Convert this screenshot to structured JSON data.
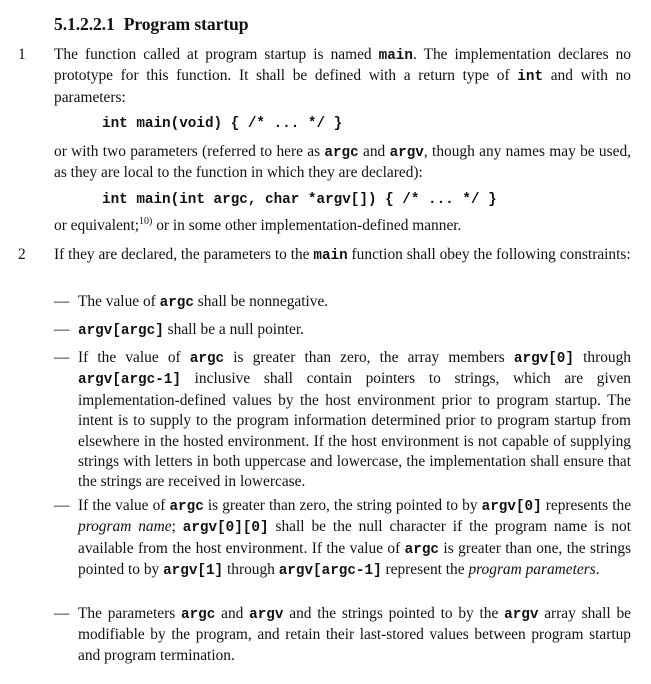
{
  "section": {
    "number": "5.1.2.2.1",
    "title": "Program startup"
  },
  "paragraphs": [
    {
      "number": "1",
      "text_1": "The function called at program startup is named ",
      "code_main": "main",
      "text_2": ". The implementation declares no prototype for this function.  It shall be defined with a return type of ",
      "code_int": "int",
      "text_3": " and with no parameters:",
      "code_example_1": "int main(void) { /* ... */ }",
      "text_4": "or with two parameters (referred to here as ",
      "code_argc": "argc",
      "text_5": " and ",
      "code_argv": "argv",
      "text_6": ", though any names may be used, as they are local to the function in which they are declared):",
      "code_example_2": "int main(int argc, char *argv[]) { /* ... */ }",
      "text_7": "or equivalent;",
      "footnote_ref": "10)",
      "text_8": " or in some other implementation-defined manner."
    },
    {
      "number": "2",
      "text_1": "If they are declared, the parameters to the ",
      "code_main": "main",
      "text_2": " function shall obey the following constraints:"
    }
  ],
  "constraints": [
    {
      "dash": "—",
      "t1": "The value of ",
      "c1": "argc",
      "t2": " shall be nonnegative."
    },
    {
      "dash": "—",
      "c1": "argv[argc]",
      "t1": " shall be a null pointer."
    },
    {
      "dash": "—",
      "t1": "If the value of ",
      "c1": "argc",
      "t2": " is greater than zero, the array members ",
      "c2": "argv[0]",
      "t3": " through ",
      "c3": "argv[argc-1]",
      "t4": " inclusive shall contain pointers to strings, which are given implementation-defined values by the host environment prior to program startup.  The intent is to supply to the program information determined prior to program startup from elsewhere in the hosted environment.  If the host environment is not capable of supplying strings with letters in both uppercase and lowercase, the implementation shall ensure that the strings are received in lowercase."
    },
    {
      "dash": "—",
      "t1": "If the value of ",
      "c1": "argc",
      "t2": " is greater than zero, the string pointed to by ",
      "c2": "argv[0]",
      "t3": " represents the ",
      "i1": "program name",
      "t4": "; ",
      "c3": "argv[0][0]",
      "t5": " shall be the null character if the program name is not available from the host environment.  If the value of ",
      "c4": "argc",
      "t6": " is greater than one, the strings pointed to by ",
      "c5": "argv[1]",
      "t7": " through ",
      "c6": "argv[argc-1]",
      "t8": " represent the ",
      "i2": "program parameters",
      "t9": "."
    },
    {
      "dash": "—",
      "t1": "The parameters ",
      "c1": "argc",
      "t2": " and ",
      "c2": "argv",
      "t3": " and the strings pointed to by the ",
      "c3": "argv",
      "t4": " array shall be modifiable by the program, and retain their last-stored values between program startup and program termination."
    }
  ]
}
